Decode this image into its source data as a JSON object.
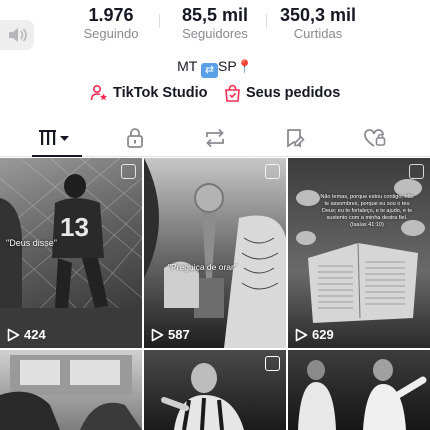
{
  "stats": [
    {
      "value": "1.976",
      "label": "Seguindo"
    },
    {
      "value": "85,5 mil",
      "label": "Seguidores"
    },
    {
      "value": "350,3 mil",
      "label": "Curtidas"
    }
  ],
  "bio": {
    "text_before": "MT ",
    "text_after": "SP"
  },
  "links": {
    "studio": "TikTok Studio",
    "orders": "Seus pedidos"
  },
  "tabs": [
    "videos-icon",
    "lock-icon",
    "repost-icon",
    "saved-icon",
    "liked-icon"
  ],
  "videos": [
    {
      "views": "424",
      "caption": "\"Deus disse\""
    },
    {
      "views": "587",
      "caption": "\"Preguiça de orar\""
    },
    {
      "views": "629",
      "caption": "Não temas, porque estou contigo; não te assombres, porque eu sou o teu Deus; eu te fortaleço, e te ajudo, e te sustento com a minha destra fiel. (Isaías 41:10)"
    },
    {
      "views": "",
      "caption": ""
    },
    {
      "views": "",
      "caption": ""
    },
    {
      "views": "",
      "caption": ""
    }
  ]
}
